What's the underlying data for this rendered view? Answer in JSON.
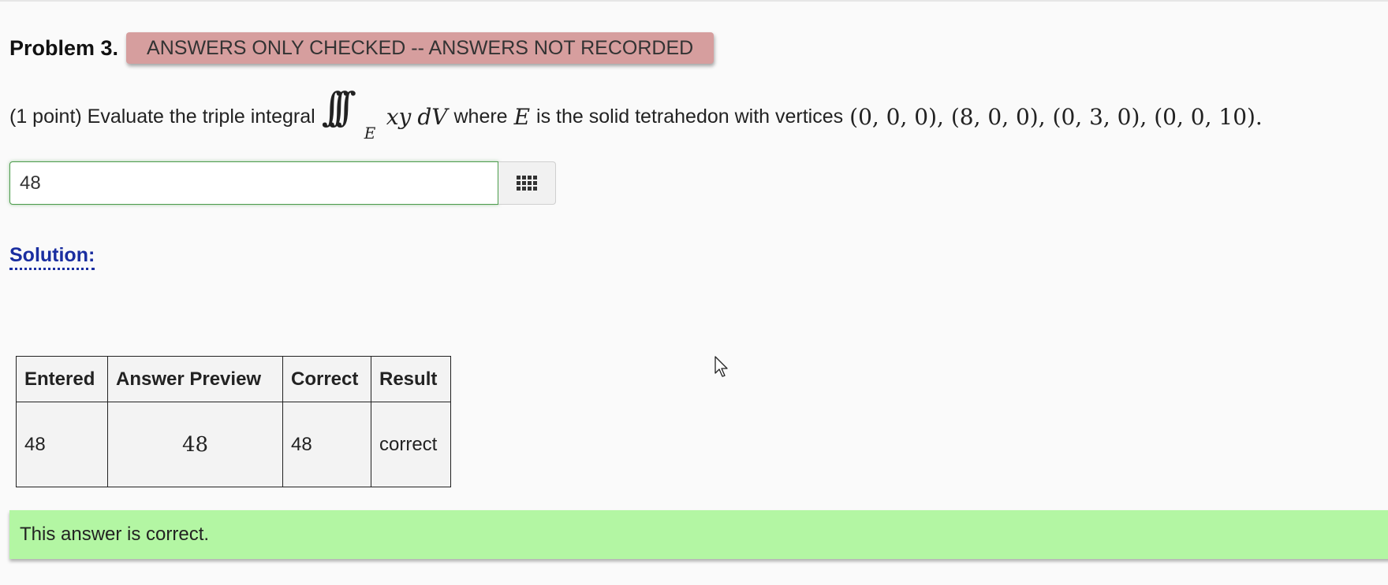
{
  "problem": {
    "title": "Problem 3.",
    "status_banner": "ANSWERS ONLY CHECKED -- ANSWERS NOT RECORDED"
  },
  "statement": {
    "intro": "(1 point) Evaluate the triple integral",
    "integral_region": "E",
    "integrand": "xy",
    "differential": "dV",
    "where_text": "where",
    "region_var": "E",
    "description": "is the solid tetrahedon with vertices",
    "vertices": "(0, 0, 0), (8, 0, 0), (0, 3, 0), (0, 0, 10)."
  },
  "answer": {
    "value": "48",
    "keypad_icon": "grid-icon"
  },
  "solution": {
    "label": "Solution:"
  },
  "results": {
    "headers": [
      "Entered",
      "Answer Preview",
      "Correct",
      "Result"
    ],
    "rows": [
      [
        "48",
        "48",
        "48",
        "correct"
      ]
    ]
  },
  "feedback": {
    "message": "This answer is correct.",
    "color": "#b3f6a3"
  },
  "colors": {
    "banner": "#d69e9e",
    "link": "#1a2ea0",
    "input_border": "#4c9c4c"
  }
}
